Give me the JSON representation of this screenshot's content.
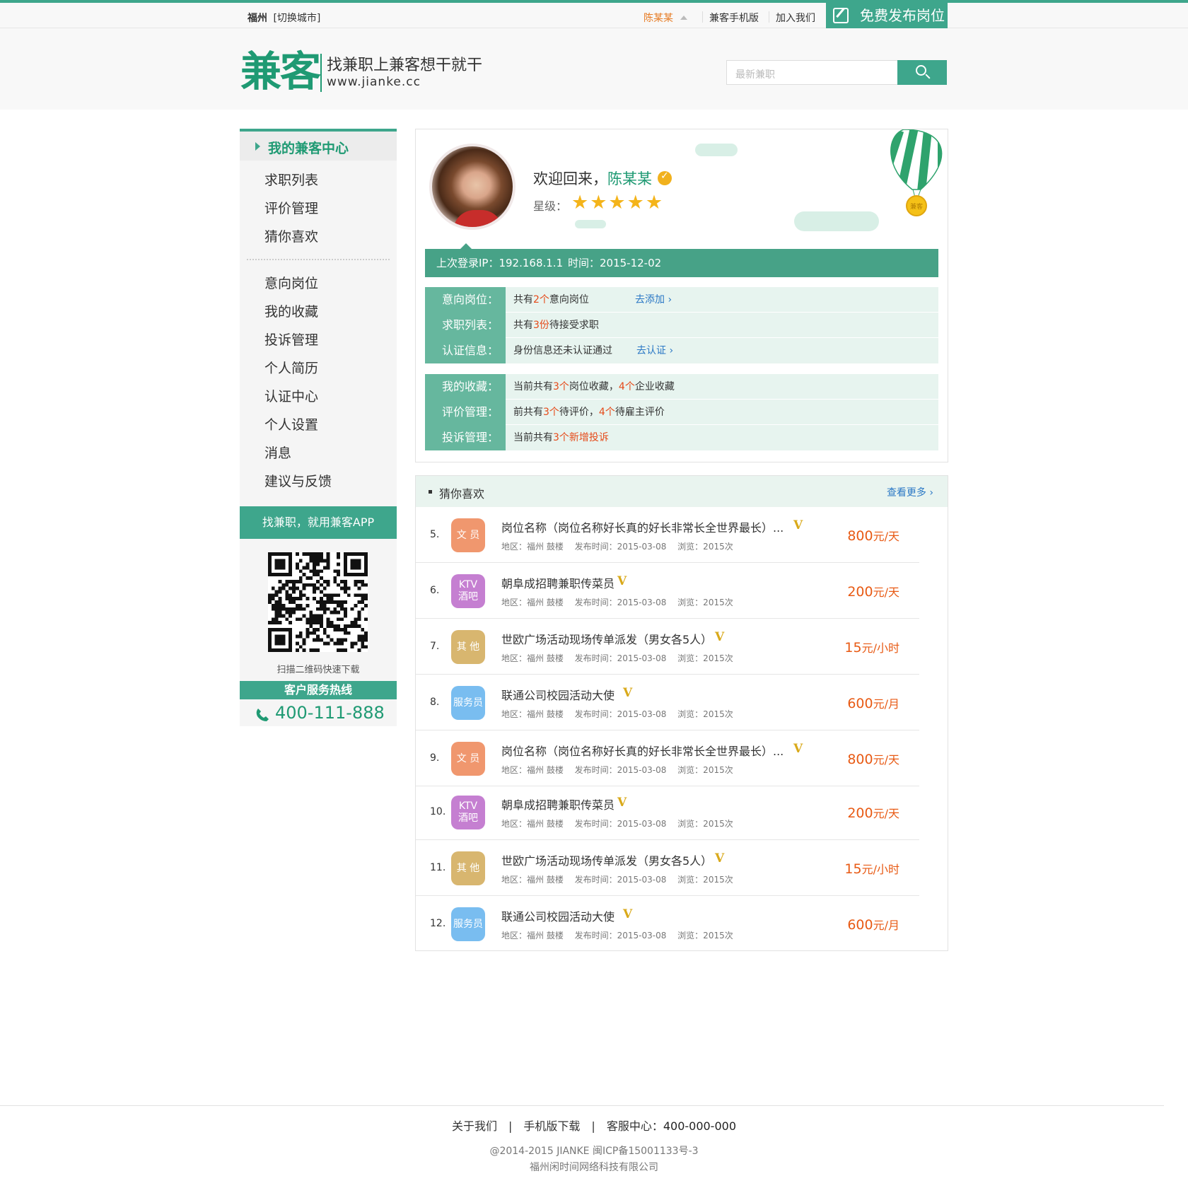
{
  "topbar": {
    "city": "福州",
    "switch_city": "[切换城市]",
    "username": "陈某某",
    "mobile": "兼客手机版",
    "join": "加入我们",
    "publish": "免费发布岗位"
  },
  "header": {
    "logo": "兼客",
    "slogan": "找兼职上兼客想干就干",
    "domain": "www.jianke.cc",
    "search_placeholder": "最新兼职"
  },
  "sidebar": {
    "active": "我的兼客中心",
    "group1": [
      "求职列表",
      "评价管理",
      "猜你喜欢"
    ],
    "group2": [
      "意向岗位",
      "我的收藏",
      "投诉管理",
      "个人简历",
      "认证中心",
      "个人设置",
      "消息",
      "建议与反馈"
    ],
    "app_band": "找兼职，就用兼客APP",
    "qr_caption": "扫描二维码快速下载",
    "hotline_label": "客户服务热线",
    "hotline_number": "400-111-888"
  },
  "profile": {
    "welcome": "欢迎回来，",
    "name": "陈某某",
    "stars_label": "星级：",
    "stars": "★★★★★",
    "balloon_text": "兼客",
    "last_ip": "上次登录IP：192.168.1.1",
    "last_time": "时间：2015-12-02"
  },
  "info1": [
    {
      "key": "意向岗位：",
      "pre": "共有",
      "n1": "2个",
      "post": "意向岗位",
      "link": "去添加 ›"
    },
    {
      "key": "求职列表：",
      "pre": "共有",
      "n1": "3份",
      "post": "待接受求职",
      "link": ""
    },
    {
      "key": "认证信息：",
      "pre": "身份信息还未认证通过",
      "n1": "",
      "post": "",
      "link": "去认证 ›"
    }
  ],
  "info2": [
    {
      "key": "我的收藏：",
      "pre": "当前共有",
      "n1": "3个",
      "mid": "岗位收藏，",
      "n2": "4个",
      "post": "企业收藏"
    },
    {
      "key": "评价管理：",
      "pre": "前共有",
      "n1": "3个",
      "mid": "待评价，",
      "n2": "4个",
      "post": "待雇主评价"
    },
    {
      "key": "投诉管理：",
      "pre": "当前共有",
      "n1": "3个新增投诉",
      "mid": "",
      "n2": "",
      "post": ""
    }
  ],
  "guess": {
    "title": "猜你喜欢",
    "more": "查看更多 ›",
    "jobs": [
      {
        "num": "5.",
        "tag": "文 员",
        "color": "#f0976e",
        "title": "岗位名称（岗位名称好长真的好长非常长全世界最长）...",
        "meta": "地区：福州 鼓楼　 发布时间：2015-03-08　 浏览：2015次",
        "amount": "800",
        "unit": "元/天"
      },
      {
        "num": "6.",
        "tag": "KTV\n酒吧",
        "color": "#c57fd1",
        "title": "朝阜成招聘兼职传菜员",
        "meta": "地区：福州 鼓楼　 发布时间：2015-03-08　 浏览：2015次",
        "amount": "200",
        "unit": "元/天"
      },
      {
        "num": "7.",
        "tag": "其 他",
        "color": "#d8b66f",
        "title": "世欧广场活动现场传单派发（男女各5人）",
        "meta": "地区：福州 鼓楼　 发布时间：2015-03-08　 浏览：2015次",
        "amount": "15",
        "unit": "元/小时"
      },
      {
        "num": "8.",
        "tag": "服务员",
        "color": "#79bdf0",
        "title": "联通公司校园活动大使",
        "meta": "地区：福州 鼓楼　 发布时间：2015-03-08　 浏览：2015次",
        "amount": "600",
        "unit": "元/月"
      },
      {
        "num": "9.",
        "tag": "文 员",
        "color": "#f0976e",
        "title": "岗位名称（岗位名称好长真的好长非常长全世界最长）...",
        "meta": "地区：福州 鼓楼　 发布时间：2015-03-08　 浏览：2015次",
        "amount": "800",
        "unit": "元/天"
      },
      {
        "num": "10.",
        "tag": "KTV\n酒吧",
        "color": "#c57fd1",
        "title": "朝阜成招聘兼职传菜员",
        "meta": "地区：福州 鼓楼　 发布时间：2015-03-08　 浏览：2015次",
        "amount": "200",
        "unit": "元/天"
      },
      {
        "num": "11.",
        "tag": "其 他",
        "color": "#d8b66f",
        "title": "世欧广场活动现场传单派发（男女各5人）",
        "meta": "地区：福州 鼓楼　 发布时间：2015-03-08　 浏览：2015次",
        "amount": "15",
        "unit": "元/小时"
      },
      {
        "num": "12.",
        "tag": "服务员",
        "color": "#79bdf0",
        "title": "联通公司校园活动大使",
        "meta": "地区：福州 鼓楼　 发布时间：2015-03-08　 浏览：2015次",
        "amount": "600",
        "unit": "元/月"
      }
    ]
  },
  "footer": {
    "about": "关于我们",
    "download": "手机版下载",
    "service_label": "客服中心：",
    "service_number": "400-000-000",
    "copyright": "@2014-2015 JIANKE 闽ICP备15001133号-3",
    "company": "福州闲时间网络科技有限公司"
  },
  "colors": {
    "brand": "#3ea68c",
    "accent_orange": "#e85a14",
    "link_blue": "#2b78c5"
  },
  "icons": [
    "edit-icon",
    "search-icon",
    "phone-icon",
    "verified-icon",
    "star-icon",
    "balloon-icon",
    "qr-code"
  ]
}
